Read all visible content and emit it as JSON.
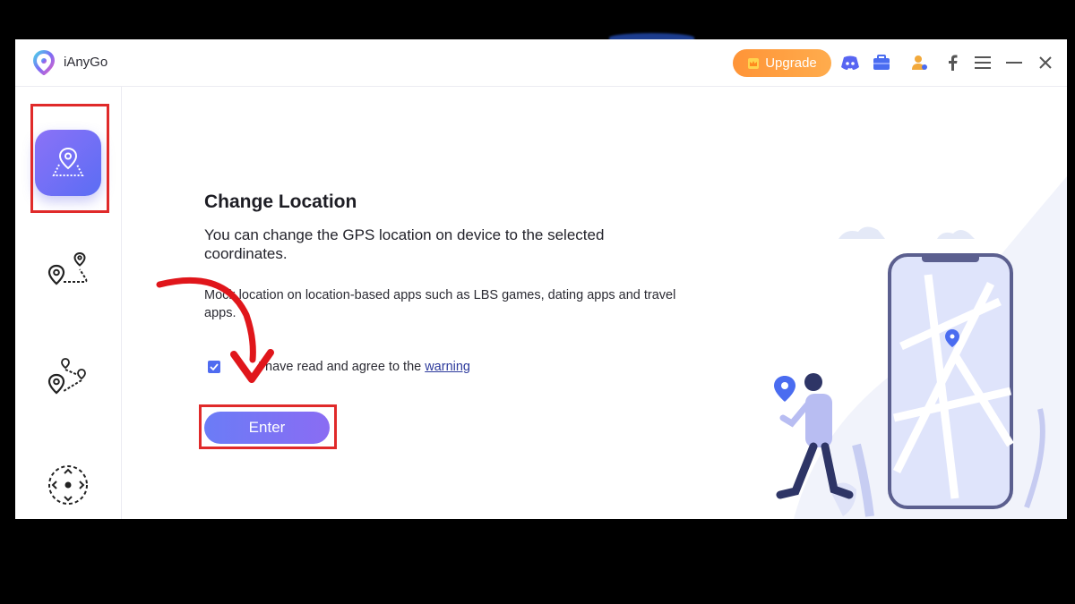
{
  "app": {
    "name": "iAnyGo"
  },
  "titlebar": {
    "upgrade_label": "Upgrade",
    "icons": [
      "discord-icon",
      "toolbox-icon",
      "account-icon",
      "facebook-icon",
      "menu-icon",
      "minimize-icon",
      "close-icon"
    ]
  },
  "sidebar": {
    "items": [
      {
        "name": "change-location",
        "icon": "location-map-icon",
        "active": true
      },
      {
        "name": "single-spot-movement",
        "icon": "two-spot-route-icon",
        "active": false
      },
      {
        "name": "multi-spot-movement",
        "icon": "multi-spot-route-icon",
        "active": false
      },
      {
        "name": "joystick-movement",
        "icon": "joystick-icon",
        "active": false
      }
    ]
  },
  "main": {
    "title": "Change Location",
    "description": "You can change the GPS location on device to the selected coordinates.",
    "note": "Mock location on location-based apps such as LBS games, dating apps and travel apps.",
    "agree_text": "I have read and agree to the",
    "warning_link": "warning",
    "agree_checked": true,
    "enter_label": "Enter"
  },
  "colors": {
    "accent": "#6b7cf6",
    "upgrade": "#ff9a3c",
    "highlight": "#e02a2a",
    "arrow": "#e0161b"
  }
}
